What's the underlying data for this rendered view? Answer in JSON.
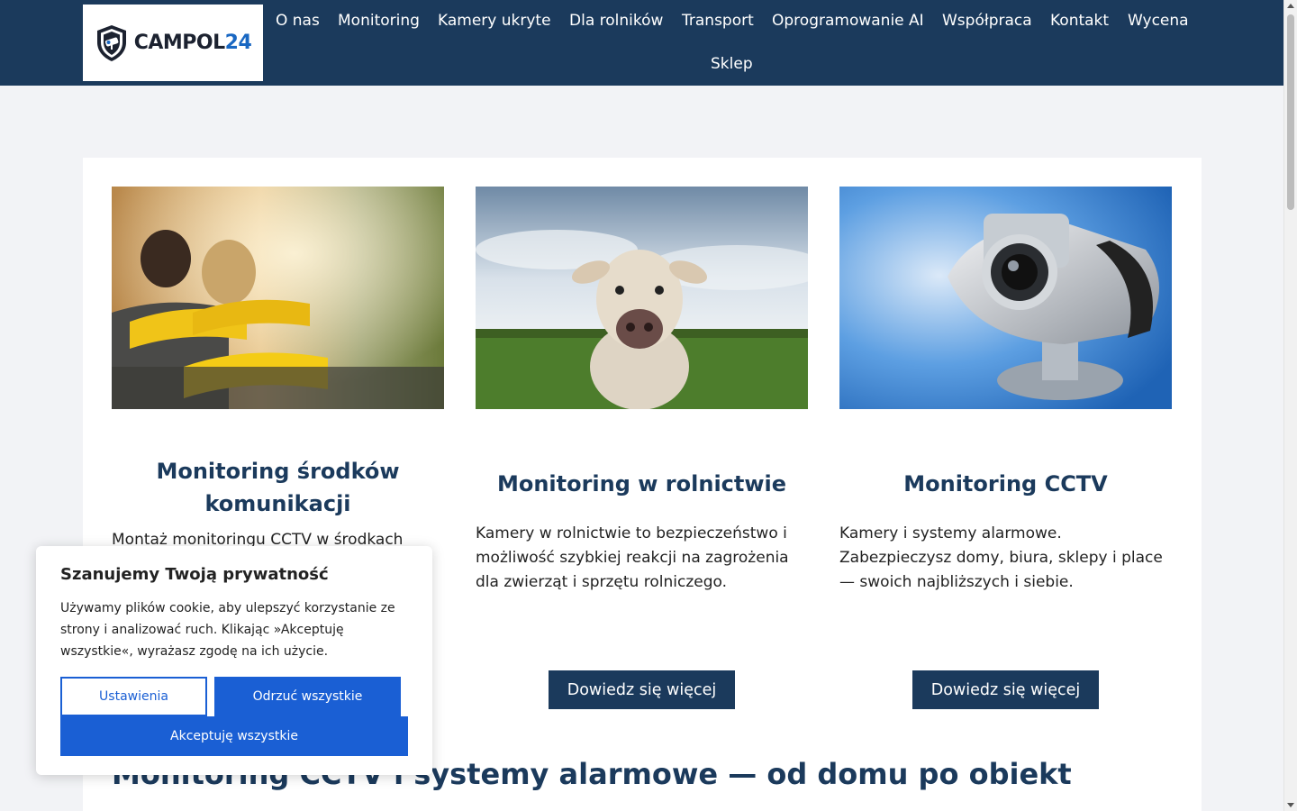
{
  "header": {
    "logo": {
      "text_main": "CAMPOL",
      "text_accent": "24"
    },
    "nav": [
      {
        "label": "O nas"
      },
      {
        "label": "Monitoring"
      },
      {
        "label": "Kamery ukryte"
      },
      {
        "label": "Dla rolników"
      },
      {
        "label": "Transport"
      },
      {
        "label": "Oprogramowanie AI"
      },
      {
        "label": "Współpraca"
      },
      {
        "label": "Kontakt"
      },
      {
        "label": "Wycena"
      },
      {
        "label": "Sklep"
      }
    ]
  },
  "cards": [
    {
      "title": "Monitoring środków komunikacji",
      "description": "Montaż monitoringu CCTV w środkach"
    },
    {
      "title": "Monitoring w rolnictwie",
      "description": "Kamery w rolnictwie to bezpieczeństwo i możliwość szybkiej reakcji na zagrożenia dla zwierząt i sprzętu rolniczego.",
      "button": "Dowiedz się więcej"
    },
    {
      "title": "Monitoring CCTV",
      "description": "Kamery i systemy alarmowe. Zabezpieczysz domy, biura, sklepy i place — swoich najbliższych i siebie.",
      "button": "Dowiedz się więcej"
    }
  ],
  "section": {
    "heading": "Monitoring CCTV i systemy alarmowe — od domu po obiekt"
  },
  "cookie_banner": {
    "title": "Szanujemy Twoją prywatność",
    "text": "Używamy plików cookie, aby ulepszyć korzystanie ze strony i analizować ruch. Klikając »Akceptuję wszystkie«, wyrażasz zgodę na ich użycie.",
    "settings_label": "Ustawienia",
    "reject_label": "Odrzuć wszystkie",
    "accept_label": "Akceptuję wszystkie"
  },
  "colors": {
    "nav_bg": "#1b3a5c",
    "accent": "#1a5fd4",
    "heading": "#1b3a5c"
  }
}
